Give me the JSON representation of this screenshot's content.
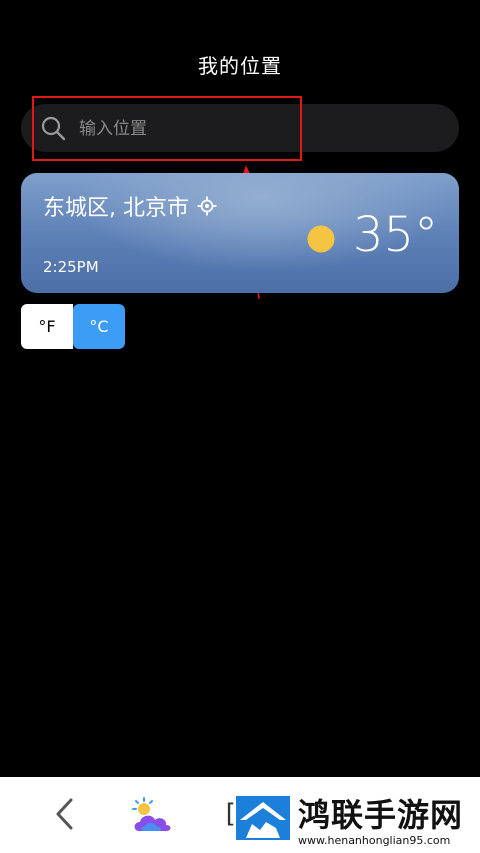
{
  "header": {
    "title": "我的位置"
  },
  "search": {
    "placeholder": "输入位置",
    "value": "",
    "icon": "search-icon"
  },
  "location_card": {
    "city": "东城区, 北京市",
    "time": "2:25PM",
    "temperature": "35°",
    "condition_icon": "sun-icon",
    "locate_icon": "locate-icon"
  },
  "unit_toggle": {
    "fahrenheit_label": "°F",
    "celsius_label": "°C",
    "selected": "°C"
  },
  "navbar": {
    "back_icon": "back-chevron-icon",
    "app_icon": "weather-app-icon",
    "partial_label": "["
  },
  "watermark": {
    "title": "鸿联手游网",
    "url": "www.henanhonglian95.com"
  },
  "colors": {
    "accent": "#3c9cf6",
    "card_top": "#7f9fcb",
    "card_bottom": "#4b6fa8",
    "annotation": "#e01818",
    "sun": "#f6c443"
  }
}
